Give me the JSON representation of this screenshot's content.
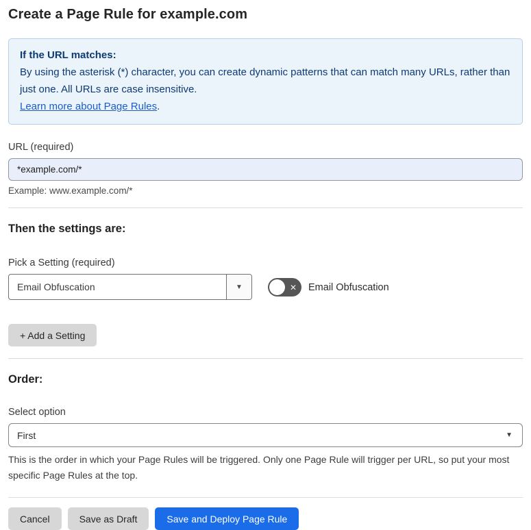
{
  "page": {
    "title": "Create a Page Rule for example.com"
  },
  "info_box": {
    "heading": "If the URL matches:",
    "body": "By using the asterisk (*) character, you can create dynamic patterns that can match many URLs, rather than just one. All URLs are case insensitive.",
    "link_label": "Learn more about Page Rules",
    "link_suffix": "."
  },
  "url_section": {
    "label": "URL (required)",
    "value": "*example.com/*",
    "example": "Example: www.example.com/*"
  },
  "settings_section": {
    "heading": "Then the settings are:",
    "picker_label": "Pick a Setting (required)",
    "picker_value": "Email Obfuscation",
    "toggle_label": "Email Obfuscation",
    "toggle_state": "off",
    "add_setting_label": "+ Add a Setting"
  },
  "order_section": {
    "heading": "Order:",
    "select_label": "Select option",
    "select_value": "First",
    "help_text": "This is the order in which your Page Rules will be triggered. Only one Page Rule will trigger per URL, so put your most specific Page Rules at the top."
  },
  "footer": {
    "cancel_label": "Cancel",
    "save_draft_label": "Save as Draft",
    "deploy_label": "Save and Deploy Page Rule"
  },
  "icons": {
    "select_arrow": "▼",
    "toggle_x": "✕"
  },
  "colors": {
    "info_bg": "#ebf3fb",
    "info_border": "#b7cfe9",
    "info_text": "#0e3a74",
    "link_blue": "#1c5dc8",
    "input_bg": "#e9eefb",
    "primary_button": "#1a6ce8",
    "gray_button": "#d7d7d7",
    "toggle_off": "#565656"
  }
}
